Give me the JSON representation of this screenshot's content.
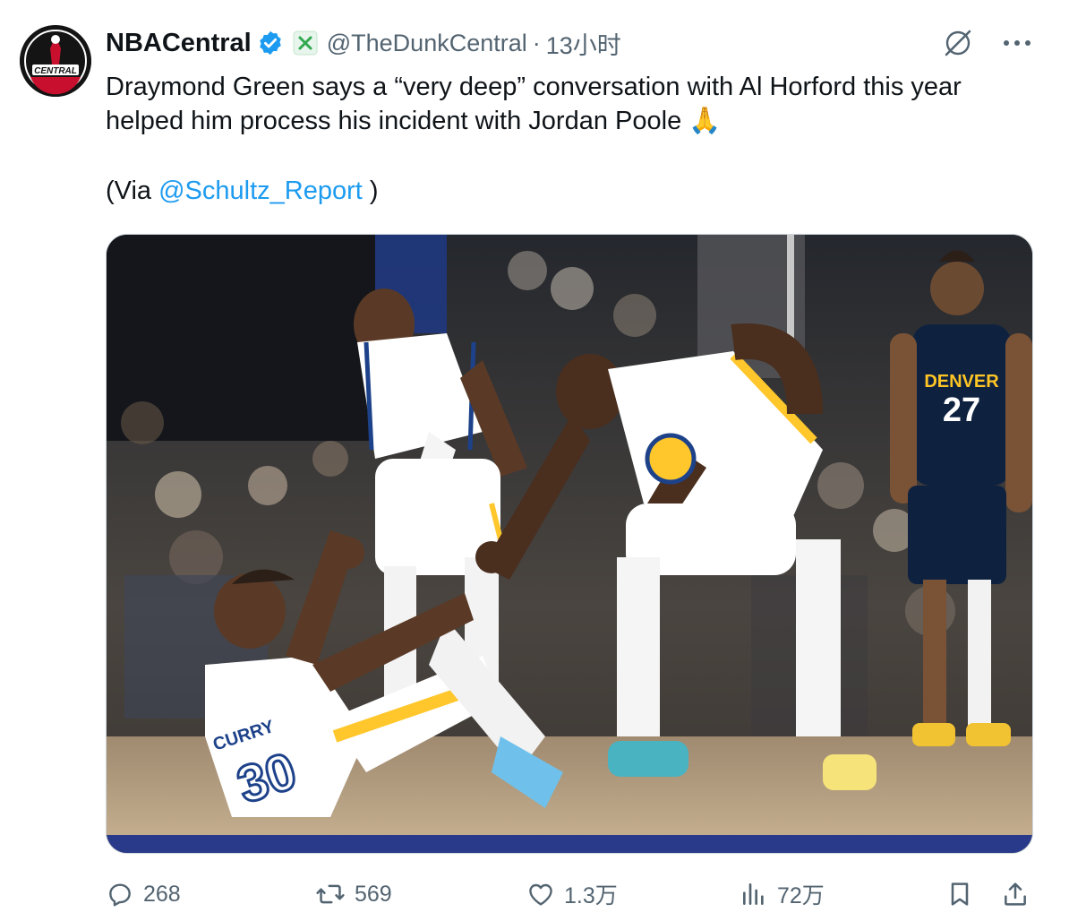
{
  "author": {
    "display_name": "NBACentral",
    "handle": "@TheDunkCentral",
    "time": "13小时",
    "avatar_text": "CENTRAL"
  },
  "tweet": {
    "text_line1": "Draymond Green says a “very deep” conversation with Al Horford this year",
    "text_line2": "helped him process his incident with Jordan Poole",
    "emoji": "🙏",
    "via_prefix": "(Via ",
    "via_mention": "@Schultz_Report",
    "via_suffix": " )"
  },
  "media": {
    "jersey_denver": "DENVER",
    "number_denver": "27",
    "name_curry": "CURRY",
    "number_curry": "30"
  },
  "actions": {
    "replies": "268",
    "retweets": "569",
    "likes": "1.3万",
    "views": "72万"
  },
  "colors": {
    "accent": "#1d9bf0",
    "secondary_text": "#536471",
    "warriors_blue": "#1d428a",
    "warriors_gold": "#ffc72c",
    "nuggets_navy": "#0e2240"
  }
}
